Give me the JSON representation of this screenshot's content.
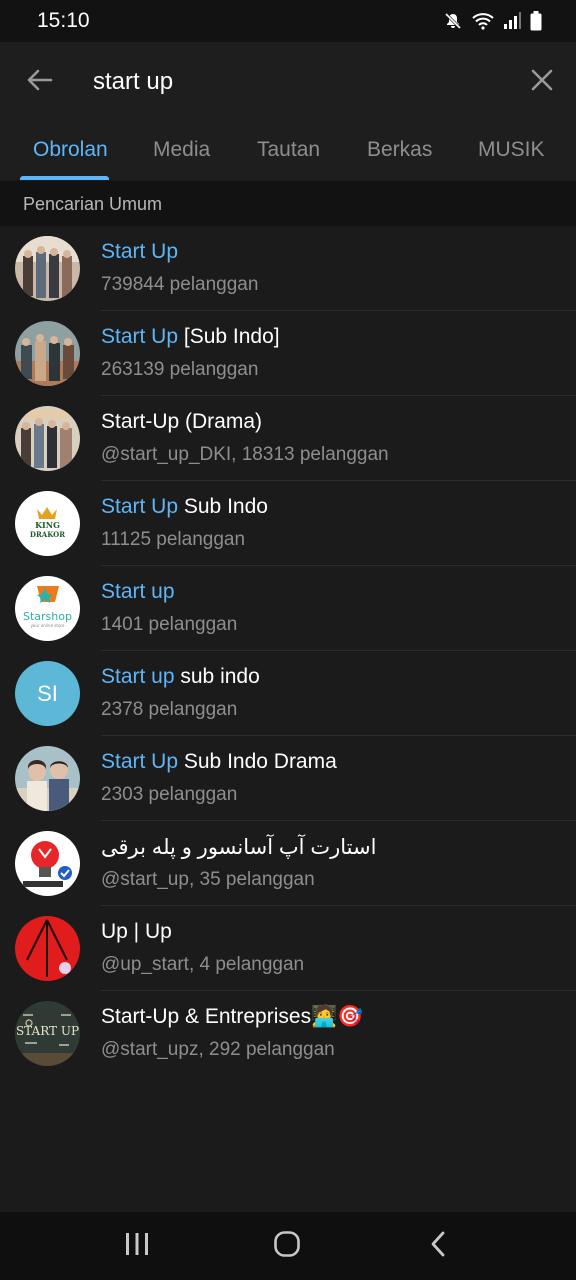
{
  "status_bar": {
    "time": "15:10",
    "icons": [
      "mute-icon",
      "wifi-icon",
      "signal-icon",
      "battery-icon"
    ]
  },
  "search": {
    "query": "start up",
    "back_icon": "arrow-left-icon",
    "clear_icon": "close-icon"
  },
  "tabs": [
    {
      "label": "Obrolan",
      "active": true
    },
    {
      "label": "Media",
      "active": false
    },
    {
      "label": "Tautan",
      "active": false
    },
    {
      "label": "Berkas",
      "active": false
    },
    {
      "label": "MUSIK",
      "active": false
    }
  ],
  "section_header": "Pencarian Umum",
  "results": [
    {
      "highlight": "Start Up",
      "rest": "",
      "subtitle": "739844  pelanggan",
      "avatar": "photo"
    },
    {
      "highlight": "Start Up",
      "rest": " [Sub Indo]",
      "subtitle": "263139  pelanggan",
      "avatar": "photo"
    },
    {
      "highlight": "",
      "rest": "Start-Up (Drama)",
      "subtitle": "@start_up_DKI, 18313  pelanggan",
      "avatar": "photo"
    },
    {
      "highlight": "Start Up",
      "rest": " Sub Indo",
      "subtitle": "11125  pelanggan",
      "avatar": "logo-king-drakor"
    },
    {
      "highlight": "Start up",
      "rest": "",
      "subtitle": "1401  pelanggan",
      "avatar": "logo-starshop"
    },
    {
      "highlight": "Start up",
      "rest": " sub indo",
      "subtitle": "2378  pelanggan",
      "avatar": "initials",
      "initials": "SI"
    },
    {
      "highlight": "Start Up",
      "rest": " Sub Indo Drama",
      "subtitle": "2303  pelanggan",
      "avatar": "photo"
    },
    {
      "highlight": "",
      "rest": "استارت آپ آسانسور و پله برقی",
      "subtitle": "@start_up, 35  pelanggan",
      "avatar": "logo-lightbulb",
      "rtl": true
    },
    {
      "highlight": "",
      "rest": "Up | Up",
      "subtitle": "@up_start, 4  pelanggan",
      "avatar": "logo-red"
    },
    {
      "highlight": "",
      "rest": "Start-Up & Entreprises🧑‍💻🎯",
      "subtitle": "@start_upz, 292  pelanggan",
      "avatar": "logo-chalkboard"
    }
  ],
  "colors": {
    "accent": "#5eb5f7",
    "background": "#1b1b1b",
    "muted_text": "#8e8e8e"
  },
  "nav_bar": {
    "icons": [
      "recent-apps-icon",
      "home-icon",
      "back-icon"
    ]
  }
}
